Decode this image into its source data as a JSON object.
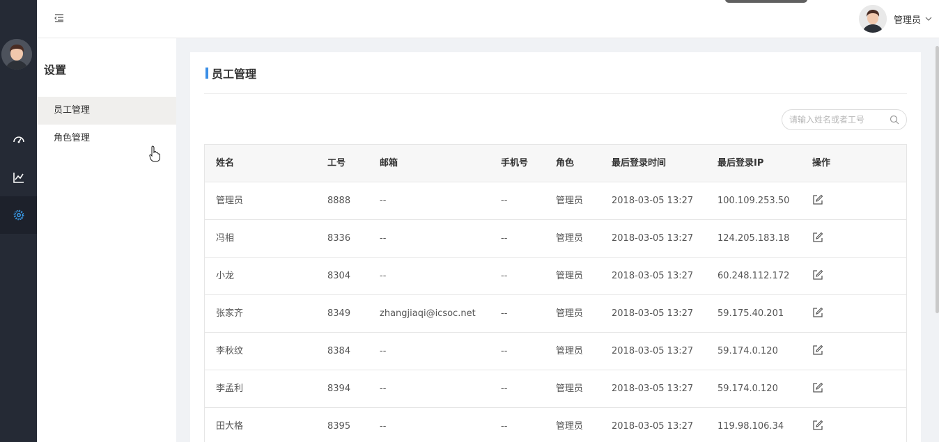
{
  "sidebar": {
    "items": [
      {
        "icon": "dashboard-icon"
      },
      {
        "icon": "chart-line-icon"
      },
      {
        "icon": "gear-icon",
        "active": true
      }
    ],
    "accent": "#3a9be9"
  },
  "header": {
    "user_name": "管理员"
  },
  "subnav": {
    "title": "设置",
    "items": [
      {
        "label": "员工管理",
        "active": true
      },
      {
        "label": "角色管理"
      }
    ]
  },
  "main": {
    "title": "员工管理",
    "search_placeholder": "请输入姓名或者工号",
    "columns": [
      "姓名",
      "工号",
      "邮箱",
      "手机号",
      "角色",
      "最后登录时间",
      "最后登录IP",
      "操作"
    ],
    "rows": [
      {
        "name": "管理员",
        "id": "8888",
        "email": "--",
        "phone": "--",
        "role": "管理员",
        "time": "2018-03-05 13:27",
        "ip": "100.109.253.50"
      },
      {
        "name": "冯相",
        "id": "8336",
        "email": "--",
        "phone": "--",
        "role": "管理员",
        "time": "2018-03-05 13:27",
        "ip": "124.205.183.18"
      },
      {
        "name": "小龙",
        "id": "8304",
        "email": "--",
        "phone": "--",
        "role": "管理员",
        "time": "2018-03-05 13:27",
        "ip": "60.248.112.172"
      },
      {
        "name": "张家齐",
        "id": "8349",
        "email": "zhangjiaqi@icsoc.net",
        "phone": "--",
        "role": "管理员",
        "time": "2018-03-05 13:27",
        "ip": "59.175.40.201"
      },
      {
        "name": "李秋纹",
        "id": "8384",
        "email": "--",
        "phone": "--",
        "role": "管理员",
        "time": "2018-03-05 13:27",
        "ip": "59.174.0.120"
      },
      {
        "name": "李孟利",
        "id": "8394",
        "email": "--",
        "phone": "--",
        "role": "管理员",
        "time": "2018-03-05 13:27",
        "ip": "59.174.0.120"
      },
      {
        "name": "田大格",
        "id": "8395",
        "email": "--",
        "phone": "--",
        "role": "管理员",
        "time": "2018-03-05 13:27",
        "ip": "119.98.106.34"
      }
    ]
  }
}
